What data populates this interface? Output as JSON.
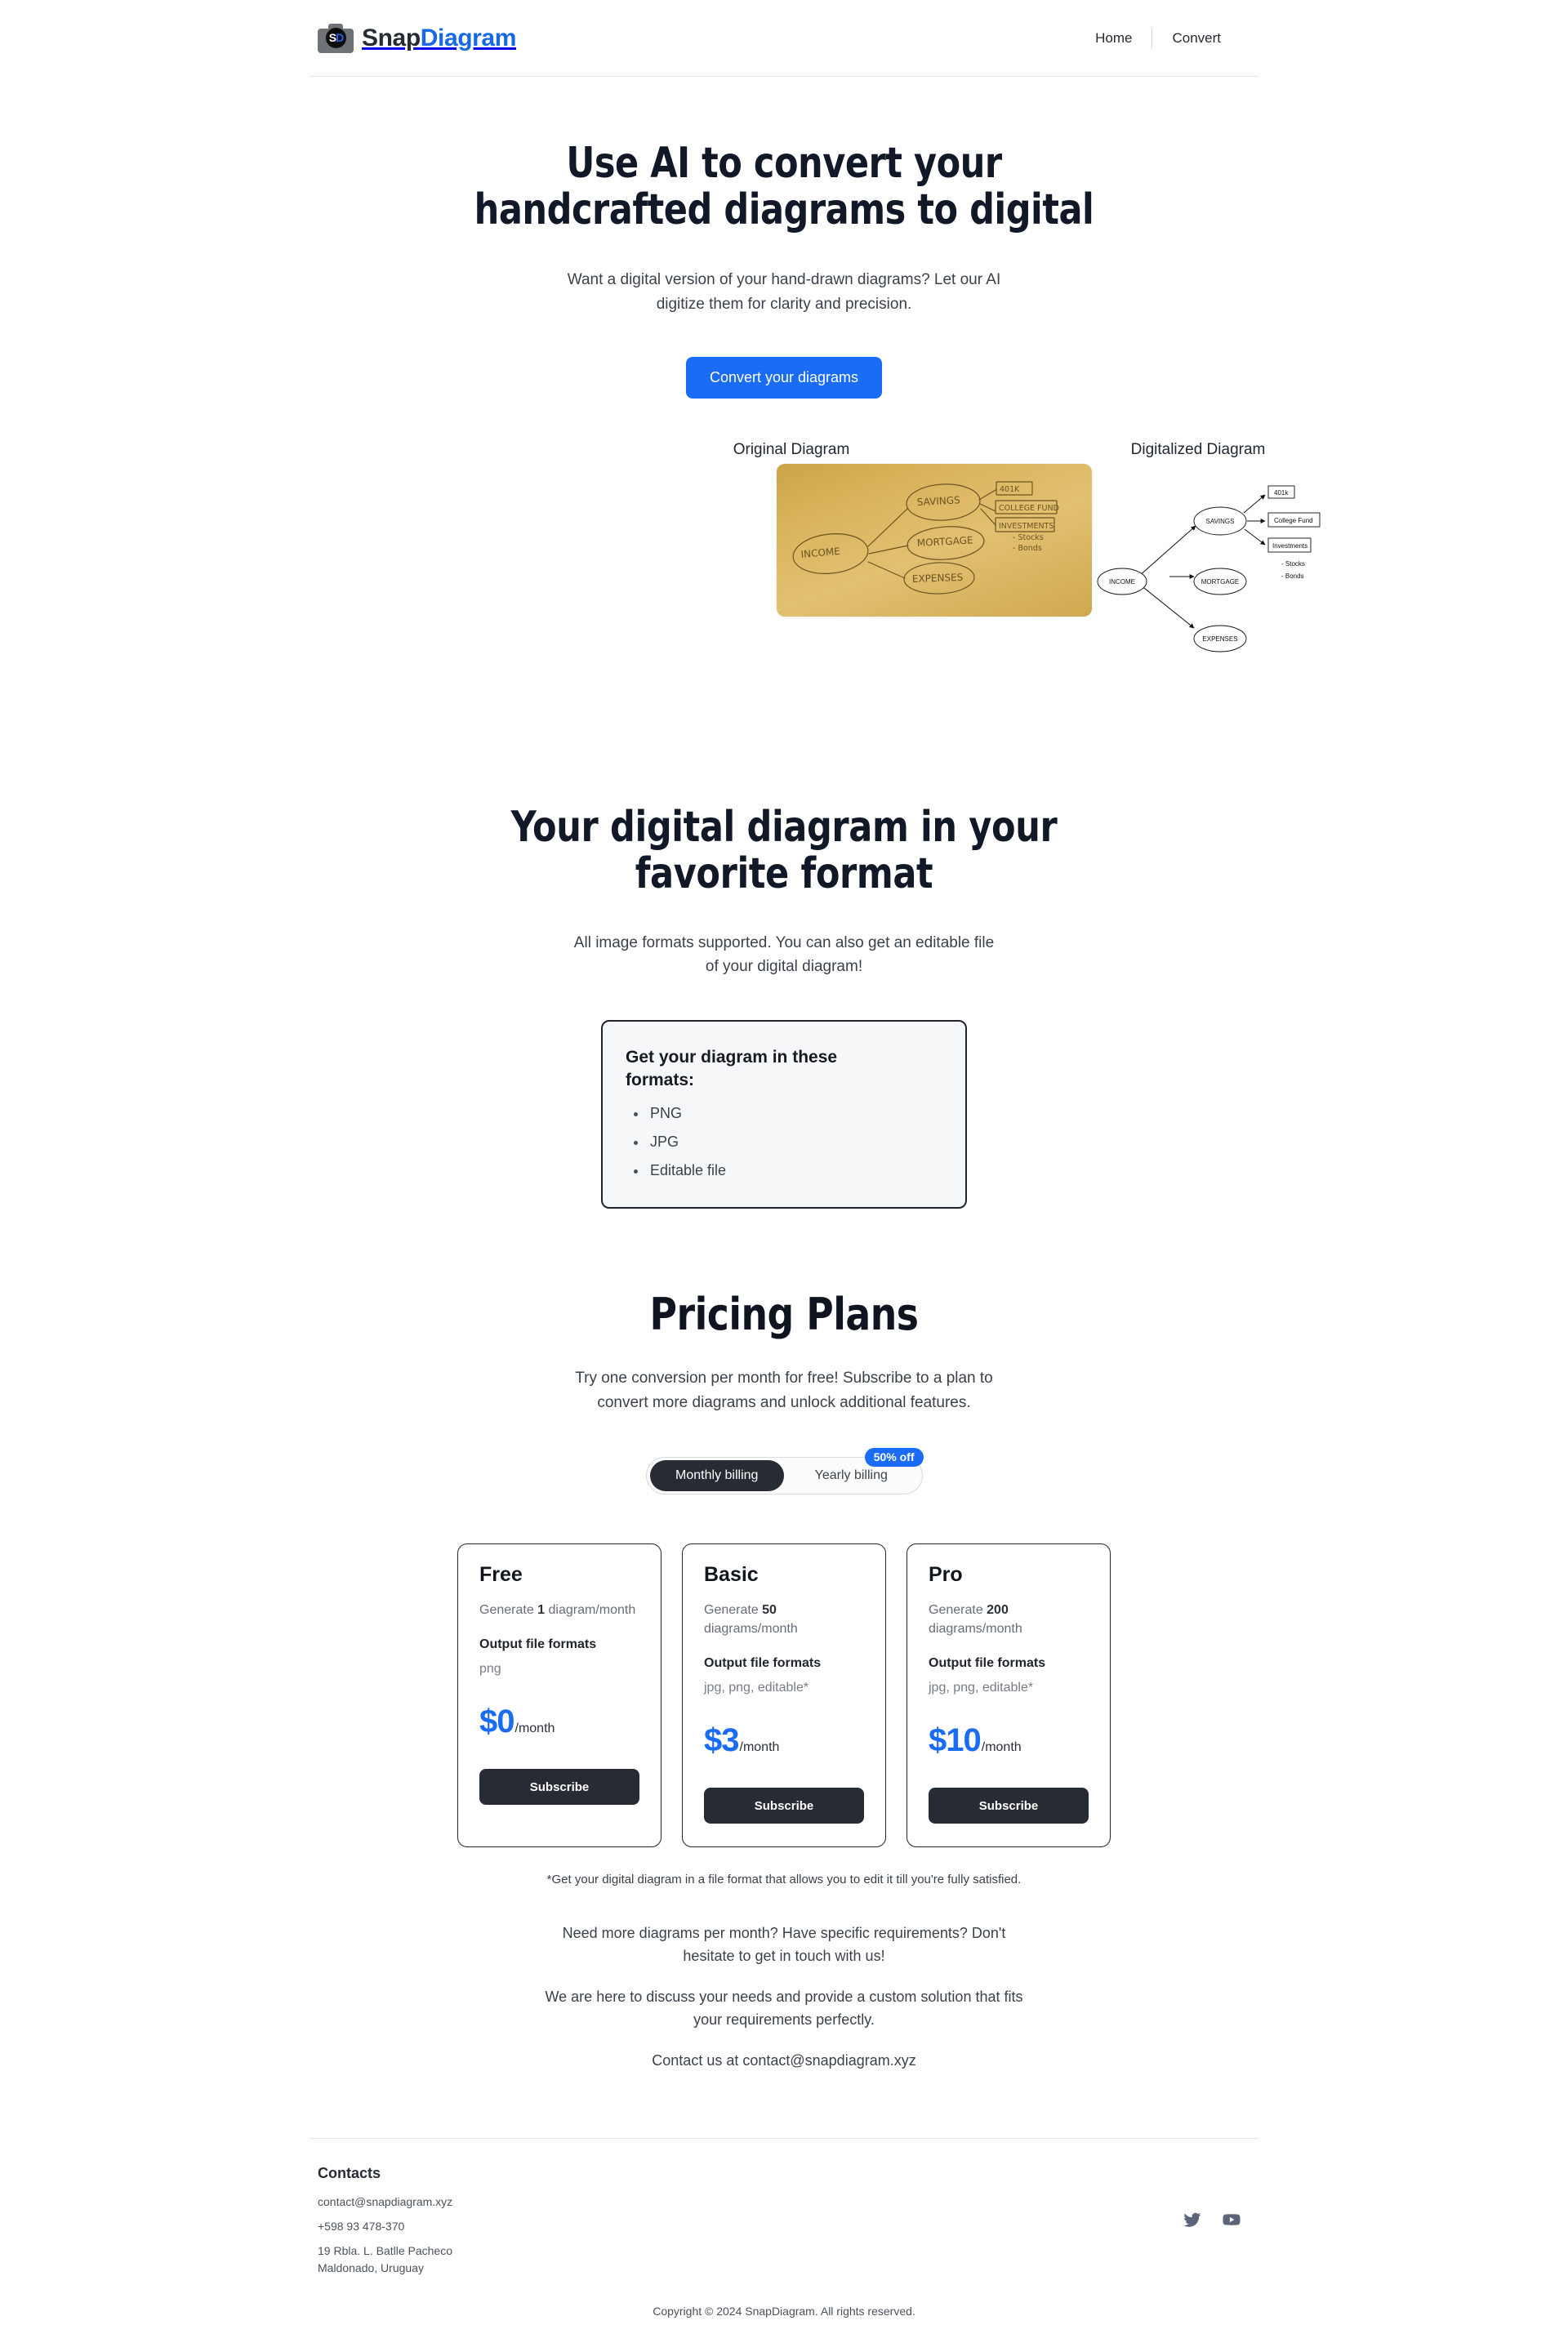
{
  "header": {
    "brand": {
      "snap": "Snap",
      "diagram": "Diagram",
      "logo_s": "S",
      "logo_d": "D"
    },
    "nav": [
      {
        "label": "Home",
        "name": "nav-link-home"
      },
      {
        "label": "Convert",
        "name": "nav-link-convert"
      }
    ]
  },
  "hero": {
    "title_line1": "Use AI to convert your",
    "title_line2": "handcrafted diagrams to digital",
    "subtitle_line1": "Want a digital version of your hand-drawn diagrams? Let our AI",
    "subtitle_line2": "digitize them for clarity and precision.",
    "cta_label": "Convert your diagrams",
    "cta_color": "#1a6bf5"
  },
  "compare": {
    "original_label": "Original Diagram",
    "digital_label": "Digitalized Diagram",
    "nodes": {
      "income": "INCOME",
      "savings": "SAVINGS",
      "mortgage": "MORTGAGE",
      "expenses": "EXPENSES",
      "box_401k": "401k",
      "box_college": "College Fund",
      "box_investments": "Investments",
      "note_stocks": "- Stocks",
      "note_bonds": "- Bonds"
    },
    "handdrawn_nodes": {
      "income": "INCOME",
      "savings": "SAVINGS",
      "mortgage": "MORTGAGE",
      "expenses": "EXPENSES",
      "box_401k": "401K",
      "box_college": "COLLEGE FUND",
      "box_investments": "INVESTMENTS",
      "note_stocks": "- Stocks",
      "note_bonds": "- Bonds"
    }
  },
  "formats": {
    "title_line1": "Your digital diagram in your",
    "title_line2": "favorite format",
    "subtitle_line1": "All image formats supported. You can also get an editable file",
    "subtitle_line2": "of your digital diagram!",
    "card_title": "Get your diagram in these formats:",
    "items": [
      "PNG",
      "JPG",
      "Editable file"
    ]
  },
  "pricing": {
    "title": "Pricing Plans",
    "subtitle_line1": "Try one conversion per month for free! Subscribe to a plan to",
    "subtitle_line2": "convert more diagrams and unlock additional features.",
    "billing": {
      "monthly_label": "Monthly billing",
      "yearly_label": "Yearly billing",
      "active": "monthly",
      "badge": "50% off",
      "badge_color": "#1a6bf5"
    },
    "plans": [
      {
        "name": "Free",
        "quota_prefix": "Generate ",
        "quota_number": "1",
        "quota_suffix": " diagram/month",
        "formats_title": "Output file formats",
        "formats": "png",
        "price": "$0",
        "per": "/month",
        "button": "Subscribe"
      },
      {
        "name": "Basic",
        "quota_prefix": "Generate ",
        "quota_number": "50",
        "quota_suffix": " diagrams/month",
        "formats_title": "Output file formats",
        "formats": "jpg, png, editable*",
        "price": "$3",
        "per": "/month",
        "button": "Subscribe"
      },
      {
        "name": "Pro",
        "quota_prefix": "Generate ",
        "quota_number": "200",
        "quota_suffix": " diagrams/month",
        "formats_title": "Output file formats",
        "formats": "jpg, png, editable*",
        "price": "$10",
        "per": "/month",
        "button": "Subscribe"
      }
    ],
    "footnote": "*Get your digital diagram in a file format that allows you to edit it till you're fully satisfied.",
    "contact_line1": "Need more diagrams per month? Have specific requirements? Don't hesitate to get in touch with us!",
    "contact_line2": "We are here to discuss your needs and provide a custom solution that fits your requirements perfectly.",
    "contact_line3": "Contact us at contact@snapdiagram.xyz"
  },
  "footer": {
    "contacts_title": "Contacts",
    "email": "contact@snapdiagram.xyz",
    "phone": "+598 93 478-370",
    "address_line1": "19 Rbla. L. Batlle Pacheco",
    "address_line2": "Maldonado, Uruguay",
    "social": [
      {
        "name": "twitter-icon",
        "label": "Twitter"
      },
      {
        "name": "youtube-icon",
        "label": "YouTube"
      }
    ],
    "copyright": "Copyright © 2024 SnapDiagram. All rights reserved."
  }
}
